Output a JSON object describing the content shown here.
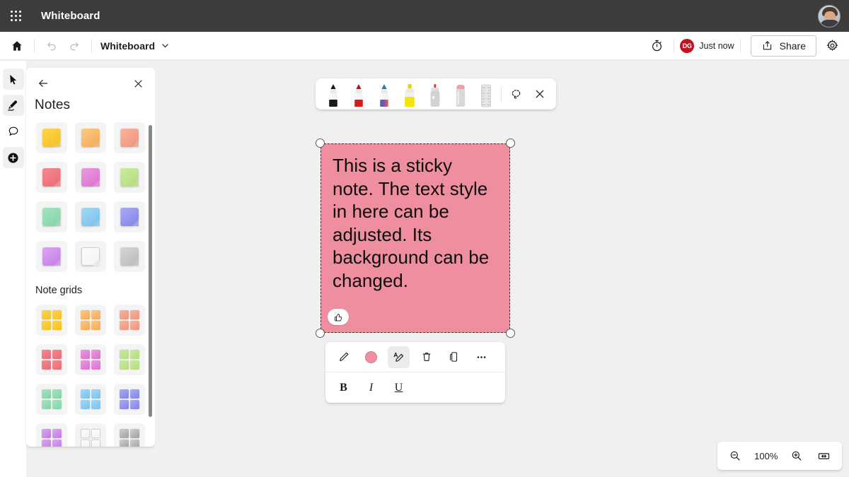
{
  "suite_bar": {
    "app_launcher_label": "app-launcher",
    "title": "Whiteboard",
    "avatar_label": "user-avatar"
  },
  "command_bar": {
    "home_label": "Home",
    "undo_label": "Undo",
    "redo_label": "Redo",
    "doc_title": "Whiteboard",
    "timer_label": "Timer",
    "presence_initials": "DG",
    "presence_status": "Just now",
    "share_label": "Share",
    "settings_label": "Settings"
  },
  "tool_rail": {
    "items": [
      {
        "name": "select-tool",
        "label": "Select",
        "active": true
      },
      {
        "name": "pen-tool",
        "label": "Ink",
        "active": true
      },
      {
        "name": "comment-tool",
        "label": "Comment",
        "active": false
      },
      {
        "name": "create-tool",
        "label": "Create",
        "active": true
      }
    ]
  },
  "notes_panel": {
    "back_label": "Back",
    "close_label": "Close",
    "title": "Notes",
    "section_label": "Note grids",
    "note_colors": [
      {
        "name": "yellow",
        "top": "#fbd64a",
        "bottom": "#f6bf20"
      },
      {
        "name": "orange",
        "top": "#fbc988",
        "bottom": "#f5a94f"
      },
      {
        "name": "peach",
        "top": "#f7b49c",
        "bottom": "#f1937a"
      },
      {
        "name": "red",
        "top": "#f4888f",
        "bottom": "#ec6a75"
      },
      {
        "name": "magenta",
        "top": "#e99be0",
        "bottom": "#dd6fd0"
      },
      {
        "name": "light-green",
        "top": "#cbe9a1",
        "bottom": "#b4dd7c"
      },
      {
        "name": "green",
        "top": "#a6e3c0",
        "bottom": "#81d4a6"
      },
      {
        "name": "blue",
        "top": "#a4d8f4",
        "bottom": "#74c2ee"
      },
      {
        "name": "indigo",
        "top": "#a9aaf2",
        "bottom": "#8183ea"
      },
      {
        "name": "purple",
        "top": "#d9a6f0",
        "bottom": "#c57ae6"
      },
      {
        "name": "white",
        "top": "#fdfdfd",
        "bottom": "#f2f2f2"
      },
      {
        "name": "grey",
        "top": "#d6d6d6",
        "bottom": "#b9b9b9"
      }
    ],
    "grid_colors": [
      {
        "name": "yellow",
        "top": "#fbd64a",
        "bottom": "#f6bf20"
      },
      {
        "name": "orange",
        "top": "#fbc988",
        "bottom": "#f5a94f"
      },
      {
        "name": "peach",
        "top": "#f7b49c",
        "bottom": "#f1937a"
      },
      {
        "name": "red",
        "top": "#f4888f",
        "bottom": "#ec6a75"
      },
      {
        "name": "magenta",
        "top": "#e99be0",
        "bottom": "#dd6fd0"
      },
      {
        "name": "light-green",
        "top": "#cbe9a1",
        "bottom": "#b4dd7c"
      },
      {
        "name": "green",
        "top": "#a6e3c0",
        "bottom": "#81d4a6"
      },
      {
        "name": "blue",
        "top": "#a4d8f4",
        "bottom": "#74c2ee"
      },
      {
        "name": "indigo",
        "top": "#a9aaf2",
        "bottom": "#8183ea"
      },
      {
        "name": "purple",
        "top": "#d9a6f0",
        "bottom": "#c57ae6"
      },
      {
        "name": "white",
        "top": "#fdfdfd",
        "bottom": "#f2f2f2"
      },
      {
        "name": "grey",
        "top": "#cfcfcf",
        "bottom": "#9e9e9e"
      }
    ]
  },
  "pen_toolbar": {
    "pens": [
      {
        "name": "pen-black",
        "label": "Black pen",
        "color": "#1b1b1b",
        "cap": "#1b1b1b",
        "kind": "pen"
      },
      {
        "name": "pen-red",
        "label": "Red pen",
        "color": "#d61b1b",
        "cap": "#b91212",
        "kind": "pen"
      },
      {
        "name": "pen-rainbow",
        "label": "Rainbow pen",
        "color": "#3a8fb7",
        "cap": "#2f7ba0",
        "kind": "rainbow"
      },
      {
        "name": "highlighter-yellow",
        "label": "Yellow highlighter",
        "color": "#f5e400",
        "cap": "#e8d800",
        "kind": "highlighter"
      },
      {
        "name": "ink-spray",
        "label": "Ink spray",
        "color": "#d2d2d2",
        "cap": "#e03030",
        "kind": "spray"
      },
      {
        "name": "eraser",
        "label": "Eraser",
        "color": "#d9d9d9",
        "cap": "#f0a0a8",
        "kind": "eraser"
      },
      {
        "name": "ruler",
        "label": "Ruler",
        "color": "#e6e6e6",
        "cap": "#cfcfcf",
        "kind": "ruler"
      }
    ],
    "lasso_label": "Lasso select",
    "close_label": "Close ink toolbar"
  },
  "sticky_note": {
    "text": "This is a sticky note. The text style in here can be adjusted. Its background can be changed.",
    "background": "#ee8e9e",
    "reaction_label": "Add reaction"
  },
  "context_toolbar": {
    "buttons": [
      {
        "name": "edit-button",
        "label": "Edit",
        "active": false
      },
      {
        "name": "note-color-button",
        "label": "Note color",
        "active": false,
        "color": "#ef8fa0"
      },
      {
        "name": "text-style-button",
        "label": "Text style",
        "active": true
      },
      {
        "name": "delete-button",
        "label": "Delete",
        "active": false
      },
      {
        "name": "duplicate-button",
        "label": "Duplicate",
        "active": false
      },
      {
        "name": "more-options-button",
        "label": "More options",
        "active": false
      }
    ],
    "format": [
      {
        "name": "bold-button",
        "label": "B"
      },
      {
        "name": "italic-button",
        "label": "I"
      },
      {
        "name": "underline-button",
        "label": "U"
      }
    ]
  },
  "zoom_widget": {
    "zoom_out_label": "Zoom out",
    "level": "100%",
    "zoom_in_label": "Zoom in",
    "fit_label": "Fit to screen"
  }
}
